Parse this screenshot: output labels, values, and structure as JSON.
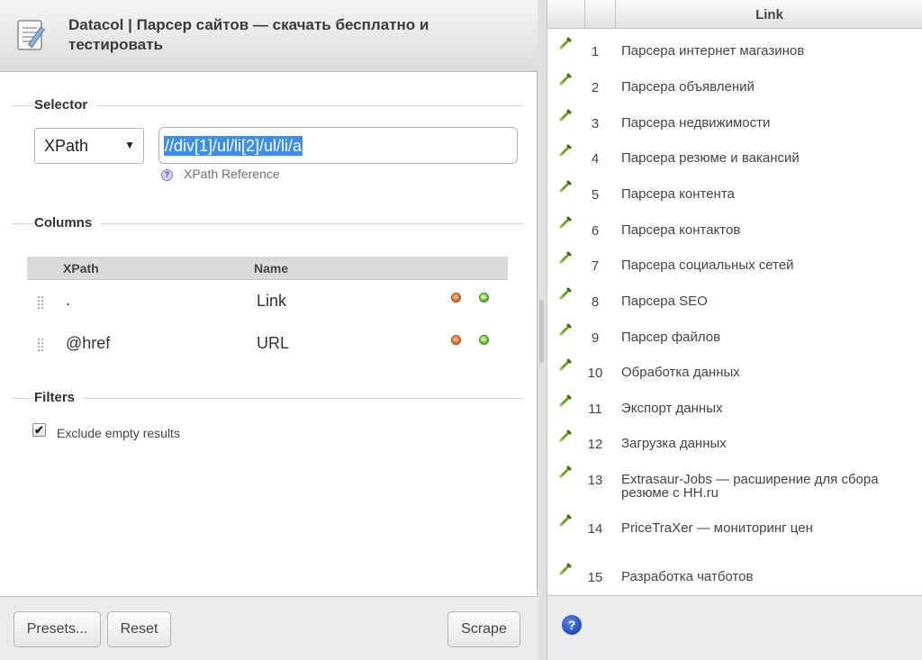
{
  "window": {
    "title": "Datacol | Парсер сайтов — скачать бесплатно и тестировать",
    "app_icon": "notepad-pencil-icon"
  },
  "selector": {
    "section_label": "Selector",
    "type_value": "XPath",
    "type_caret": "▼",
    "xpath_value": "//div[1]/ul/li[2]/ul/li/a",
    "reference_link": "XPath Reference",
    "reference_icon": "?"
  },
  "columns": {
    "section_label": "Columns",
    "headers": {
      "xpath": "XPath",
      "name": "Name"
    },
    "rows": [
      {
        "xpath": ".",
        "name": "Link"
      },
      {
        "xpath": "@href",
        "name": "URL"
      }
    ]
  },
  "filters": {
    "section_label": "Filters",
    "exclude_empty_label": "Exclude empty results",
    "exclude_empty_checked": true,
    "check_mark": "✔"
  },
  "footer": {
    "presets_label": "Presets...",
    "reset_label": "Reset",
    "scrape_label": "Scrape"
  },
  "results": {
    "column_header": "Link",
    "help_icon": "?",
    "rows": [
      {
        "num": "1",
        "text": "Парсера интернет магазинов"
      },
      {
        "num": "2",
        "text": "Парсера объявлений"
      },
      {
        "num": "3",
        "text": "Парсера недвижимости"
      },
      {
        "num": "4",
        "text": "Парсера резюме и вакансий"
      },
      {
        "num": "5",
        "text": "Парсера контента"
      },
      {
        "num": "6",
        "text": "Парсера контактов"
      },
      {
        "num": "7",
        "text": "Парсера социальных сетей"
      },
      {
        "num": "8",
        "text": "Парсера SEO"
      },
      {
        "num": "9",
        "text": "Парсер файлов"
      },
      {
        "num": "10",
        "text": "Обработка данных"
      },
      {
        "num": "11",
        "text": "Экспорт данных"
      },
      {
        "num": "12",
        "text": "Загрузка данных"
      },
      {
        "num": "13",
        "text": "Extrasaur-Jobs — расширение для сбора резюме с HH.ru"
      },
      {
        "num": "14",
        "text": "PriceTraXer — мониторинг цен"
      },
      {
        "num": "15",
        "text": "Разработка чатботов"
      }
    ]
  },
  "colors": {
    "selection": "#3d8ee8",
    "remove_button": "#e0601a",
    "add_button": "#5db32a",
    "help_icon": "#1c46b8"
  }
}
